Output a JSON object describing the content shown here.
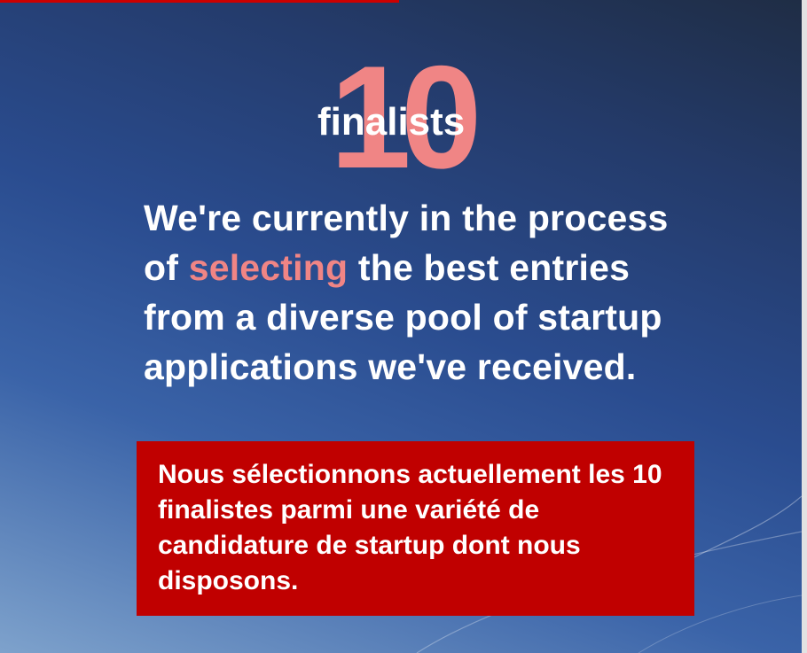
{
  "slide": {
    "big_number": "10",
    "finalists_word": "finalists",
    "headline": {
      "part1": "We're currently in the process of ",
      "highlight": "selecting",
      "part2": " the best entries from a diverse pool of startup applications we've received."
    },
    "french_box": {
      "text": "Nous sélectionnons actuellement les 10 finalistes parmi une variété de candidature de startup dont nous disposons."
    }
  },
  "colors": {
    "accent_red": "#c00000",
    "highlight_pink": "#f08585",
    "background_blue": "#2a4c8f"
  }
}
